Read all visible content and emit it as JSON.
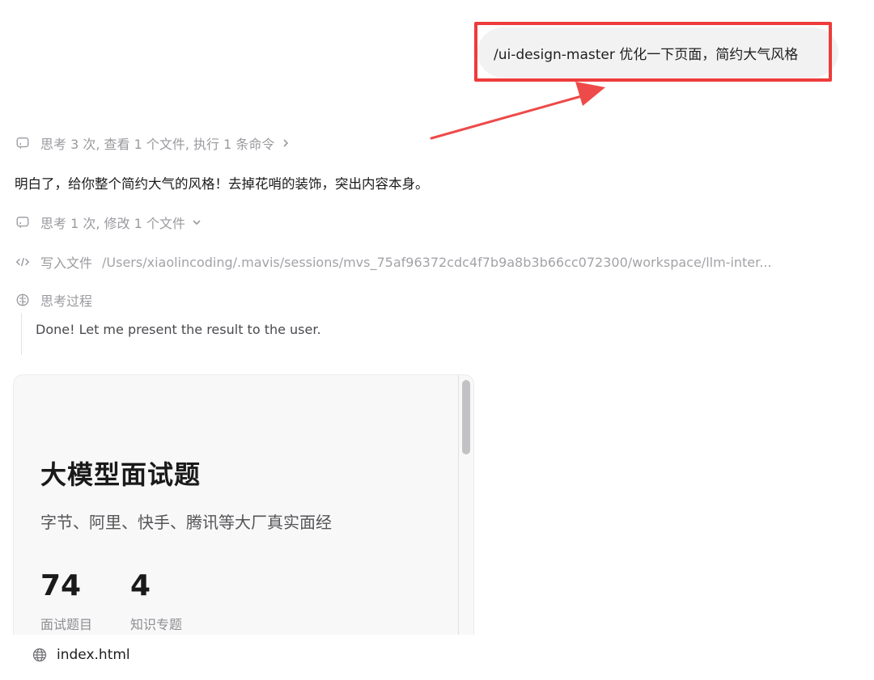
{
  "user_message": "/ui-design-master  优化一下页面，简约大气风格",
  "steps": {
    "think_1": "思考 3 次, 查看 1 个文件, 执行 1 条命令",
    "think_2": "思考 1 次, 修改 1 个文件",
    "write_label": "写入文件",
    "write_path": "/Users/xiaolincoding/.mavis/sessions/mvs_75af96372cdc4f7b9a8b3b66cc072300/workspace/llm-inter...",
    "thought_label": "思考过程",
    "thought_text": "Done! Let me present the result to the user."
  },
  "assistant_reply": "明白了，给你整个简约大气的风格！去掉花哨的装饰，突出内容本身。",
  "preview": {
    "title": "大模型面试题",
    "subtitle": "字节、阿里、快手、腾讯等大厂真实面经",
    "stats": [
      {
        "value": "74",
        "label": "面试题目"
      },
      {
        "value": "4",
        "label": "知识专题"
      }
    ]
  },
  "file": {
    "name": "index.html",
    "icon": "globe-icon"
  },
  "colors": {
    "highlight": "#ee3b3b",
    "user_bubble": "#f2f2f3",
    "muted_text": "#9a9a9f"
  },
  "icons": {
    "think": "message-square-icon",
    "chevron_right": "chevron-right-icon",
    "chevron_down": "chevron-down-icon",
    "code": "code-icon",
    "brain": "brain-icon"
  }
}
